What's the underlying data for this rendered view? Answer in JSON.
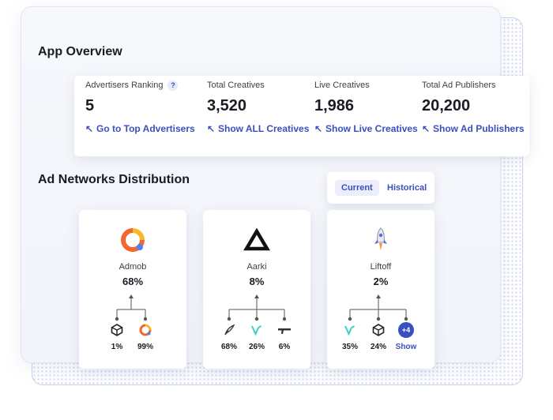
{
  "overview": {
    "title": "App Overview",
    "stats": [
      {
        "label": "Advertisers Ranking",
        "value": "5",
        "link": "Go to Top Advertisers",
        "help": "?"
      },
      {
        "label": "Total Creatives",
        "value": "3,520",
        "link": "Show ALL Creatives"
      },
      {
        "label": "Live Creatives",
        "value": "1,986",
        "link": "Show Live Creatives"
      },
      {
        "label": "Total Ad Publishers",
        "value": "20,200",
        "link": "Show Ad Publishers"
      }
    ]
  },
  "distribution": {
    "title": "Ad Networks Distribution",
    "toggle": {
      "current": "Current",
      "historical": "Historical",
      "active": "Current"
    },
    "networks": [
      {
        "name": "Admob",
        "percent": "68%",
        "icon": "admob-logo",
        "children": [
          {
            "icon": "unity-icon",
            "percent": "1%"
          },
          {
            "icon": "admob-icon",
            "percent": "99%"
          }
        ]
      },
      {
        "name": "Aarki",
        "percent": "8%",
        "icon": "aarki-logo",
        "children": [
          {
            "icon": "quill-icon",
            "percent": "68%"
          },
          {
            "icon": "vungle-icon",
            "percent": "26%"
          },
          {
            "icon": "pistol-icon",
            "percent": "6%"
          }
        ]
      },
      {
        "name": "Liftoff",
        "percent": "2%",
        "icon": "rocket-logo",
        "children": [
          {
            "icon": "vungle-icon",
            "percent": "35%"
          },
          {
            "icon": "unity-icon",
            "percent": "24%"
          },
          {
            "icon": "more-badge",
            "badge": "+4",
            "label": "Show"
          }
        ]
      }
    ]
  },
  "colors": {
    "accent": "#3a4fbf",
    "admob_orange": "#f4662f",
    "admob_yellow": "#f6b92b",
    "teal": "#3ecfc4"
  }
}
